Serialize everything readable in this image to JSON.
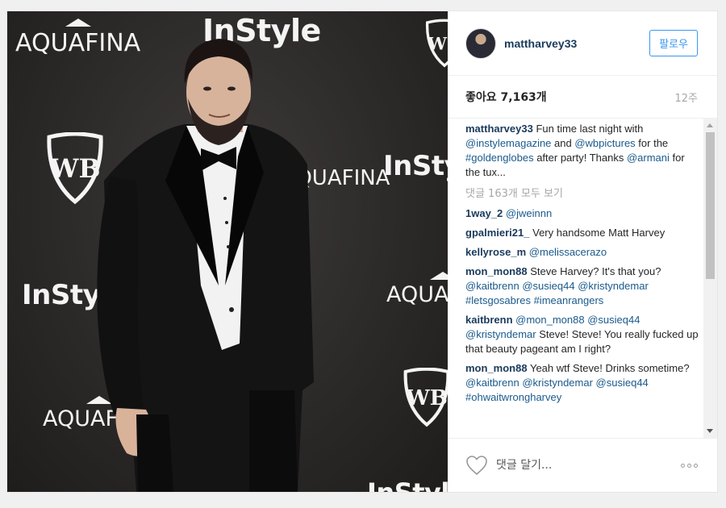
{
  "photo": {
    "wall_logos": {
      "instyle": "InStyle",
      "aquafina": "AQUAFINA",
      "wb": "WB"
    }
  },
  "post": {
    "username": "mattharvey33",
    "follow_label": "팔로우",
    "likes": "좋아요 7,163개",
    "age": "12주",
    "caption": {
      "user": "mattharvey33",
      "parts": [
        "Fun time last night with ",
        "@instylemagazine",
        " and ",
        "@wbpictures",
        " for the ",
        "#goldenglobes",
        " after party! Thanks ",
        "@armani",
        " for the tux..."
      ]
    },
    "view_all_comments": "댓글 163개 모두 보기",
    "comments": [
      {
        "user": "1way_2",
        "text": "@jweinnn"
      },
      {
        "user": "gpalmieri21_",
        "text": "Very handsome Matt Harvey"
      },
      {
        "user": "kellyrose_m",
        "text": "@melissacerazo"
      },
      {
        "user": "mon_mon88",
        "text": "Steve Harvey? It's that you? @kaitbrenn @susieq44 @kristyndemar #letsgosabres #imeanrangers"
      },
      {
        "user": "kaitbrenn",
        "text": "@mon_mon88 @susieq44 @kristyndemar Steve! Steve! You really fucked up that beauty pageant am I right?"
      },
      {
        "user": "mon_mon88",
        "text": "Yeah wtf Steve! Drinks sometime? @kaitbrenn @kristyndemar @susieq44 #ohwaitwrongharvey"
      }
    ],
    "comment_placeholder": "댓글 달기..."
  },
  "colors": {
    "username": "#1a3a5c",
    "follow": "#3897f0",
    "muted": "#a5a7aa"
  },
  "icons": {
    "like": "heart-icon",
    "more": "more-options-icon"
  }
}
